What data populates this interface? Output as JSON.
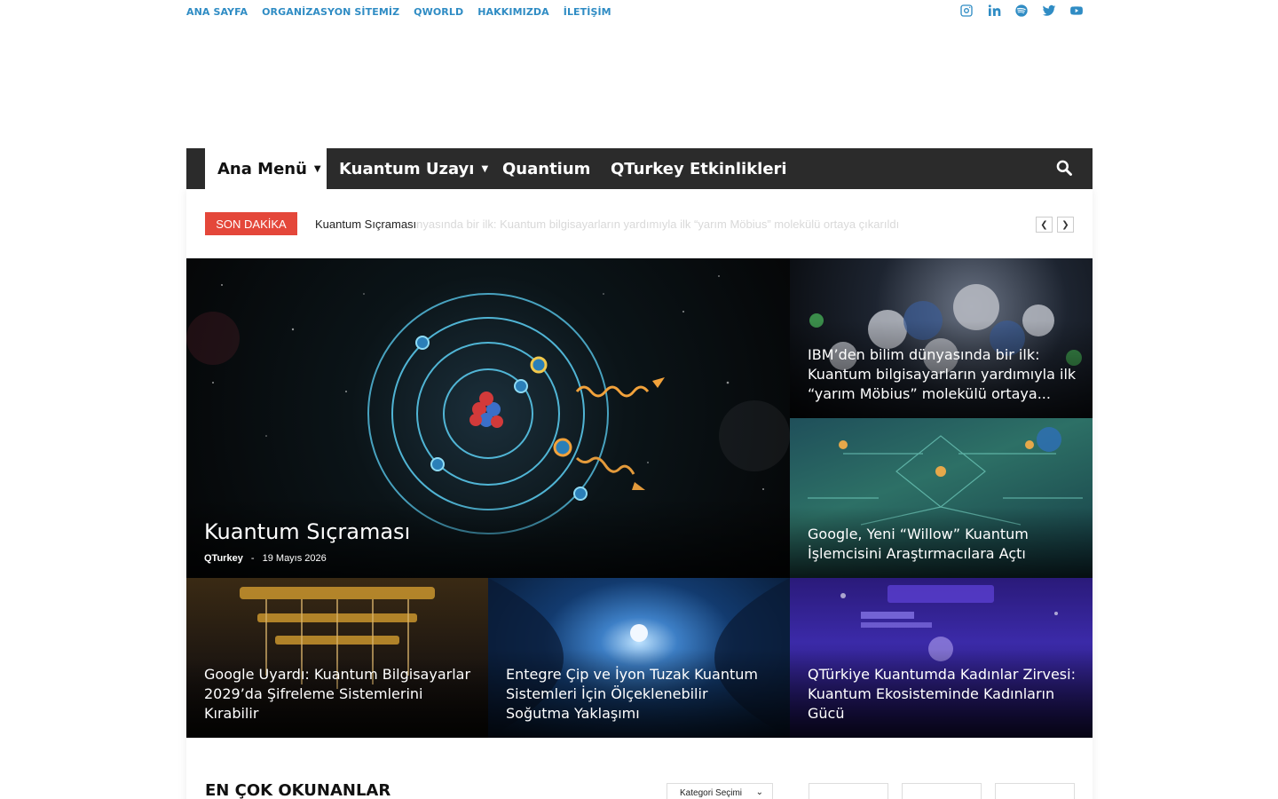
{
  "topnav": {
    "links": [
      "ANA SAYFA",
      "ORGANİZASYON SİTEMİZ",
      "QWORLD",
      "HAKKIMIZDA",
      "İLETİŞİM"
    ],
    "socials": [
      "instagram-icon",
      "linkedin-icon",
      "spotify-icon",
      "twitter-icon",
      "youtube-icon"
    ],
    "accent": "#2f8cc4"
  },
  "menu": {
    "items": [
      "Ana Menü",
      "Kuantum Uzayı",
      "Quantium",
      "QTurkey Etkinlikleri"
    ],
    "active_index": 0,
    "bar_color": "#2b2b2b"
  },
  "breaking": {
    "label": "SON DAKİKA",
    "headline": "Kuantum Sıçraması",
    "headline_faded": "nyasında bir ilk: Kuantum bilgisayarların yardımıyla ilk “yarım Möbius” molekülü ortaya çıkarıldı",
    "color": "#e4473a"
  },
  "featured": {
    "title": "Kuantum Sıçraması",
    "author": "QTurkey",
    "separator": "-",
    "date": "19 Mayıs 2026"
  },
  "side_posts": [
    "IBM’den bilim dünyasında bir ilk: Kuantum bilgisayarların yardımıyla ilk “yarım Möbius” molekülü ortaya...",
    "Google, Yeni “Willow” Kuantum İşlemcisini Araştırmacılara Açtı"
  ],
  "bottom_posts": [
    "Google Uyardı: Kuantum Bilgisayarlar 2029’da Şifreleme Sistemlerini Kırabilir",
    "Entegre Çip ve İyon Tuzak Kuantum Sistemleri İçin Ölçeklenebilir Soğutma Yaklaşımı",
    "QTürkiye Kuantumda Kadınlar Zirvesi: Kuantum Ekosisteminde Kadınların Gücü"
  ],
  "sections": {
    "most_read": "EN ÇOK OKUNANLAR",
    "category_select": "Kategori Seçimi"
  }
}
